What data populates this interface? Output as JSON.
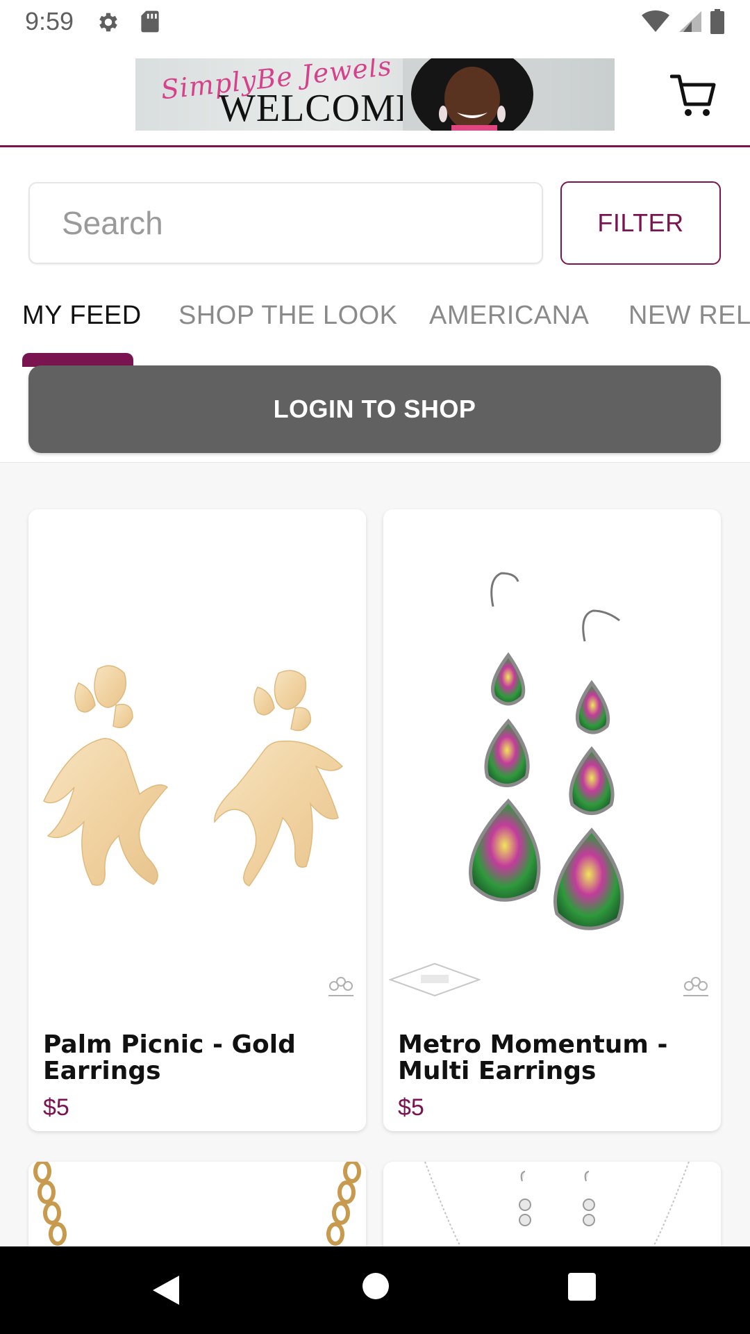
{
  "status_bar": {
    "time": "9:59",
    "icons": [
      "gear-icon",
      "sd-card-icon",
      "wifi-icon",
      "signal-icon",
      "battery-icon"
    ]
  },
  "header": {
    "banner_script": "SimplyBe Jewels",
    "banner_welcome": "WELCOME",
    "cart_icon": "cart-icon"
  },
  "search": {
    "placeholder": "Search",
    "value": "",
    "filter_label": "FILTER"
  },
  "tabs": [
    {
      "label": "MY FEED",
      "active": true
    },
    {
      "label": "SHOP THE LOOK",
      "active": false
    },
    {
      "label": "AMERICANA",
      "active": false
    },
    {
      "label": "NEW RELE",
      "active": false
    }
  ],
  "login_label": "LOGIN TO SHOP",
  "products": [
    {
      "name": "Palm Picnic - Gold Earrings",
      "price": "$5"
    },
    {
      "name": "Metro Momentum - Multi Earrings",
      "price": "$5"
    },
    {
      "name": "",
      "price": ""
    },
    {
      "name": "",
      "price": ""
    }
  ],
  "colors": {
    "accent": "#7a1450",
    "login_bg": "#616161",
    "tab_active": "#111111",
    "tab_inactive": "#8a8a8a"
  }
}
